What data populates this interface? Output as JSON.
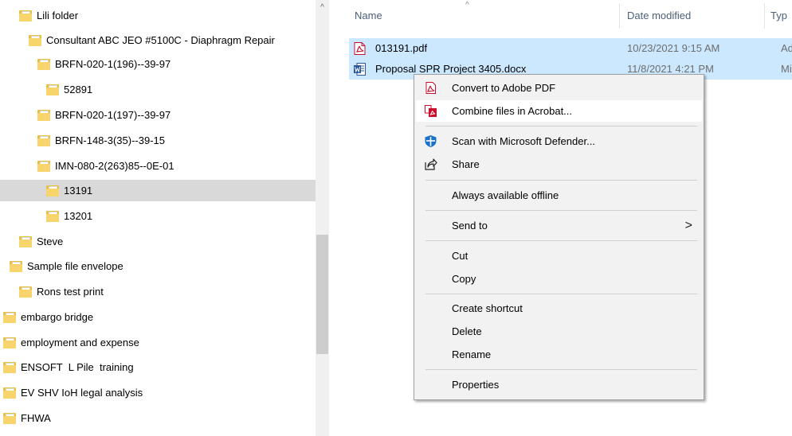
{
  "navigation_pane": {
    "items": [
      {
        "label": "Lili folder",
        "selected": false
      },
      {
        "label": "Consultant ABC JEO #5100C - Diaphragm Repair",
        "selected": false
      },
      {
        "label": "BRFN-020-1(196)--39-97",
        "selected": false
      },
      {
        "label": "52891",
        "selected": false
      },
      {
        "label": "BRFN-020-1(197)--39-97",
        "selected": false
      },
      {
        "label": "BRFN-148-3(35)--39-15",
        "selected": false
      },
      {
        "label": "IMN-080-2(263)85--0E-01",
        "selected": false
      },
      {
        "label": "13191",
        "selected": true
      },
      {
        "label": "13201",
        "selected": false
      },
      {
        "label": "Steve",
        "selected": false
      },
      {
        "label": "Sample file envelope",
        "selected": false
      },
      {
        "label": "Rons test print",
        "selected": false
      },
      {
        "label": "embargo bridge",
        "selected": false
      },
      {
        "label": "employment and expense",
        "selected": false
      },
      {
        "label": "ENSOFT  L Pile  training",
        "selected": false
      },
      {
        "label": "EV SHV IoH legal analysis",
        "selected": false
      },
      {
        "label": "FHWA",
        "selected": false
      }
    ],
    "scroll_up_glyph": "^"
  },
  "file_list": {
    "columns": {
      "name": "Name",
      "date_modified": "Date modified",
      "type": "Typ"
    },
    "sort_glyph": "^",
    "rows": [
      {
        "icon": "pdf-file-icon",
        "name": "013191.pdf",
        "date_modified": "10/23/2021 9:15 AM",
        "type": "Ad"
      },
      {
        "icon": "word-file-icon",
        "name": "Proposal SPR Project 3405.docx",
        "date_modified": "11/8/2021 4:21 PM",
        "type": "Mi"
      }
    ]
  },
  "context_menu": {
    "groups": [
      [
        {
          "label": "Convert to Adobe PDF",
          "icon": "acrobat-convert-icon"
        },
        {
          "label": "Combine files in Acrobat...",
          "icon": "acrobat-combine-icon",
          "highlighted": true
        }
      ],
      [
        {
          "label": "Scan with Microsoft Defender...",
          "icon": "defender-shield-icon"
        },
        {
          "label": "Share",
          "icon": "share-icon"
        }
      ],
      [
        {
          "label": "Always available offline"
        }
      ],
      [
        {
          "label": "Send to",
          "submenu_glyph": ">"
        }
      ],
      [
        {
          "label": "Cut"
        },
        {
          "label": "Copy"
        }
      ],
      [
        {
          "label": "Create shortcut"
        },
        {
          "label": "Delete"
        },
        {
          "label": "Rename"
        }
      ],
      [
        {
          "label": "Properties"
        }
      ]
    ]
  },
  "colors": {
    "folder": "#f7d46c",
    "selection": "#cce8ff",
    "tree_selected": "#d9d9d9",
    "menu_background": "#f2f2f2",
    "acrobat_red": "#c8102e",
    "word_blue": "#2b579a",
    "defender_blue": "#1a73c8"
  }
}
